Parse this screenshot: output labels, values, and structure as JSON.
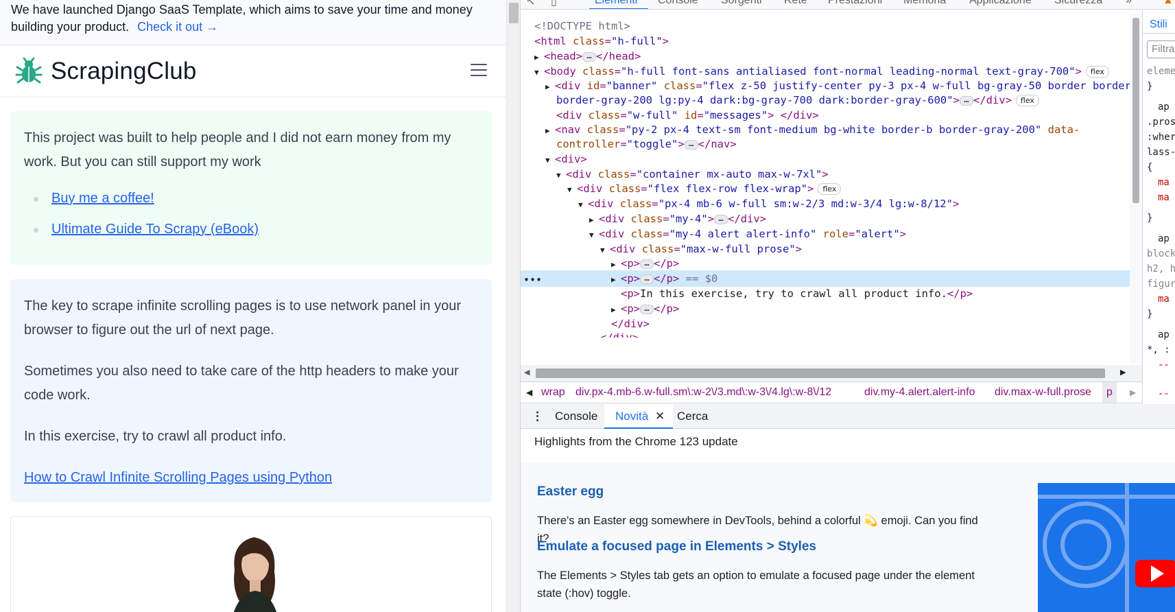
{
  "site": {
    "banner_text": "We have launched Django SaaS Template, which aims to save your time and money building your product.",
    "banner_link": "Check it out →",
    "brand": "ScrapingClub",
    "support_text": "This project was built to help people and I did not earn money from my work. But you can still support my work",
    "support_links": [
      "Buy me a coffee!",
      "Ultimate Guide To Scrapy (eBook)"
    ],
    "info_paragraphs": [
      "The key to scrape infinite scrolling pages is to use network panel in your browser to figure out the url of next page.",
      "Sometimes you also need to take care of the http headers to make your code work.",
      "In this exercise, try to crawl all product info."
    ],
    "info_link": "How to Crawl Infinite Scrolling Pages using Python"
  },
  "devtools": {
    "tabs": [
      "Elementi",
      "Console",
      "Sorgenti",
      "Rete",
      "Prestazioni",
      "Memoria",
      "Applicazione",
      "Sicurezza",
      "»"
    ],
    "dom": {
      "doctype": "<!DOCTYPE html>",
      "html_tag": "<html ",
      "html_cls_attr": "class",
      "html_cls": "\"h-full\"",
      "head": "<head>",
      "head_close": "</head>",
      "body_tag": "<body ",
      "body_cls": "\"h-full font-sans antialiased font-normal leading-normal text-gray-700\"",
      "body_end": ">",
      "div_open": "<div ",
      "banner_id_attr": "id",
      "banner_id": "\"banner\"",
      "cls_attr": "class",
      "banner_cls1": "\"flex z-50 justify-center py-3 px-4 w-full bg-gray-50 border border-b",
      "banner_cls2": "border-gray-200 lg:py-4 dark:bg-gray-700 dark:border-gray-600\"",
      "div_close": "</div>",
      "msg_cls": "\"w-full\"",
      "msg_id_attr": "id",
      "msg_id": "\"messages\"",
      "nav_tag": "<nav ",
      "nav_cls": "\"py-2 px-4 text-sm font-medium bg-white border-b border-gray-200\"",
      "nav_data_attr": "data-",
      "nav_data_attr2": "controller",
      "nav_data_val": "\"toggle\"",
      "nav_close": "</nav>",
      "div": "<div>",
      "container_cls": "\"container mx-auto max-w-7xl\"",
      "flex_cls": "\"flex flex-row flex-wrap\"",
      "col_cls": "\"px-4 mb-6 w-full sm:w-2/3 md:w-3/4 lg:w-8/12\"",
      "my4_cls": "\"my-4\"",
      "alert_cls": "\"my-4 alert alert-info\"",
      "role_attr": "role",
      "role_val": "\"alert\"",
      "prose_cls": "\"max-w-full prose\"",
      "p_open": "<p>",
      "p_close": "</p>",
      "sel_marker": "== $0",
      "p_text_open": "<p>",
      "p_text": "In this exercise, try to crawl all product info.",
      "p_text_close": "</p>",
      "div_close2": "</div>",
      "div_close3": "</div>",
      "gt": ">",
      "flex_badge": "flex",
      "ellipsis": "…"
    },
    "breadcrumbs": [
      "wrap",
      "div.px-4.mb-6.w-full.sm\\:w-2\\/3.md\\:w-3\\/4.lg\\:w-8\\/12",
      "div.my-4.alert.alert-info",
      "div.max-w-full.prose",
      "p"
    ],
    "styles_tab": "Stili",
    "styles_filter": "Filtra",
    "styles_lines": [
      "eleme",
      "}",
      "ap",
      ".pros",
      ":wher",
      "lass-",
      "{",
      "ma",
      "ma",
      "}",
      "ap",
      "block",
      "h2, h",
      "figur",
      "ma",
      "}",
      "ap",
      "*, :",
      "--",
      "--"
    ],
    "drawer_tabs": [
      "Console",
      "Novità",
      "Cerca"
    ],
    "whats_new": {
      "title": "Highlights from the Chrome 123 update",
      "h1": "Easter egg",
      "p1": "There's an Easter egg somewhere in DevTools, behind a colorful 💫 emoji. Can you find it?",
      "h2": "Emulate a focused page in Elements > Styles",
      "p2": "The Elements > Styles tab gets an option to emulate a focused page under the element state (:hov) toggle."
    }
  },
  "colors": {
    "link": "#2563eb",
    "support_bg": "#f0fdf4",
    "info_bg": "#eff6ff",
    "devtools_accent": "#1a73e8",
    "tag": "#881280",
    "attr_name": "#994500",
    "attr_value": "#1a1aa6"
  }
}
